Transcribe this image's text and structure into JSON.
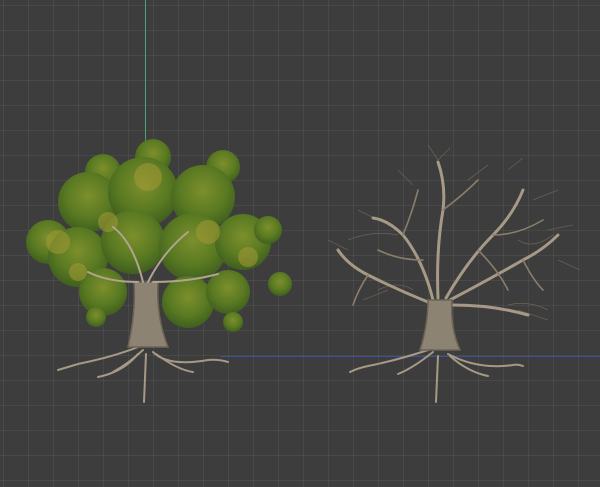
{
  "scene": {
    "colors": {
      "background": "#3d3d3d",
      "grid_line": "#4a4a4a",
      "axis_y": "#4aa37a",
      "axis_x": "#3f4f9a",
      "foliage_dark": "#3f5f1e",
      "foliage_mid": "#6b8b2a",
      "foliage_light": "#a49a36",
      "bark": "#a69a86",
      "bark_shadow": "#6d6456",
      "bare_branches": "#8a7d6a"
    },
    "objects": [
      {
        "name": "tree-with-foliage",
        "icon": "tree-leafy-icon"
      },
      {
        "name": "tree-bare-branches",
        "icon": "tree-bare-icon"
      }
    ]
  }
}
